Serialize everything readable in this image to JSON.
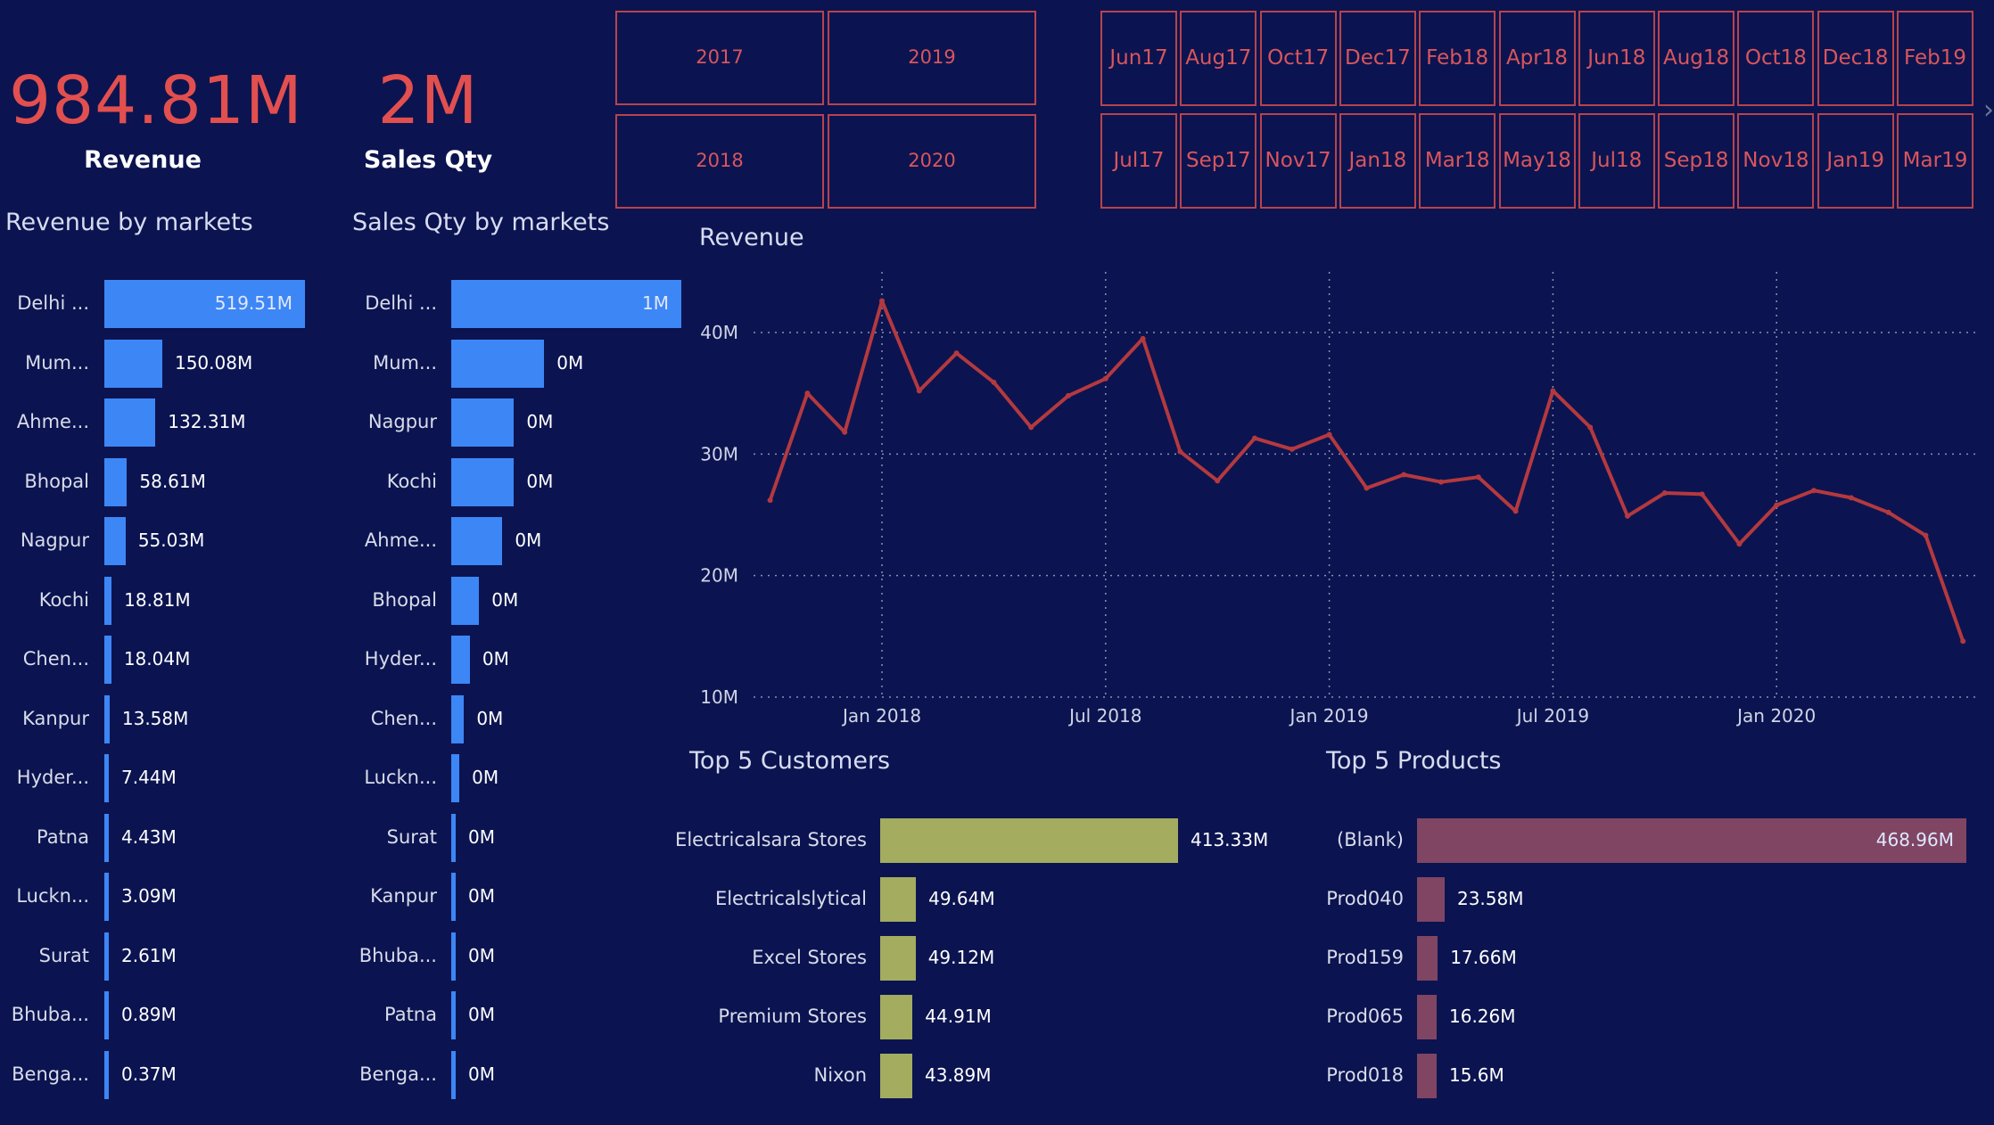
{
  "kpis": {
    "revenue": {
      "value": "984.81M",
      "label": "Revenue"
    },
    "sales_qty": {
      "value": "2M",
      "label": "Sales Qty"
    }
  },
  "year_slicer": {
    "items": [
      "2017",
      "2019",
      "2018",
      "2020"
    ]
  },
  "month_slicer": {
    "top_row": [
      {
        "m": "Jun",
        "y": "17"
      },
      {
        "m": "Aug",
        "y": "17"
      },
      {
        "m": "Oct",
        "y": "17"
      },
      {
        "m": "Dec",
        "y": "17"
      },
      {
        "m": "Feb",
        "y": "18"
      },
      {
        "m": "Apr",
        "y": "18"
      },
      {
        "m": "Jun",
        "y": "18"
      },
      {
        "m": "Aug",
        "y": "18"
      },
      {
        "m": "Oct",
        "y": "18"
      },
      {
        "m": "Dec",
        "y": "18"
      },
      {
        "m": "Feb",
        "y": "19"
      }
    ],
    "bottom_row": [
      {
        "m": "Jul",
        "y": "17"
      },
      {
        "m": "Sep",
        "y": "17"
      },
      {
        "m": "Nov",
        "y": "17"
      },
      {
        "m": "Jan",
        "y": "18"
      },
      {
        "m": "Mar",
        "y": "18"
      },
      {
        "m": "May",
        "y": "18"
      },
      {
        "m": "Jul",
        "y": "18"
      },
      {
        "m": "Sep",
        "y": "18"
      },
      {
        "m": "Nov",
        "y": "18"
      },
      {
        "m": "Jan",
        "y": "19"
      },
      {
        "m": "Mar",
        "y": "19"
      }
    ],
    "scroll_icon": "chevron-right-icon"
  },
  "colors": {
    "background": "#0b1450",
    "kpi": "#e24f4f",
    "market_bar": "#3d86f5",
    "line": "#b4393f",
    "customer_bar": "#a3ac5f",
    "product_bar": "#7f4563",
    "slicer_border": "#b8434c"
  },
  "chart_data": [
    {
      "id": "revenue_by_markets",
      "type": "bar",
      "orientation": "horizontal",
      "title": "Revenue by markets",
      "categories": [
        "Delhi ...",
        "Mum...",
        "Ahme...",
        "Bhopal",
        "Nagpur",
        "Kochi",
        "Chen...",
        "Kanpur",
        "Hyder...",
        "Patna",
        "Luckn...",
        "Surat",
        "Bhuba...",
        "Benga..."
      ],
      "values": [
        519.51,
        150.08,
        132.31,
        58.61,
        55.03,
        18.81,
        18.04,
        13.58,
        7.44,
        4.43,
        3.09,
        2.61,
        0.89,
        0.37
      ],
      "labels": [
        "519.51M",
        "150.08M",
        "132.31M",
        "58.61M",
        "55.03M",
        "18.81M",
        "18.04M",
        "13.58M",
        "7.44M",
        "4.43M",
        "3.09M",
        "2.61M",
        "0.89M",
        "0.37M"
      ],
      "unit": "M"
    },
    {
      "id": "sales_qty_by_markets",
      "type": "bar",
      "orientation": "horizontal",
      "title": "Sales Qty by markets",
      "categories": [
        "Delhi ...",
        "Mum...",
        "Nagpur",
        "Kochi",
        "Ahme...",
        "Bhopal",
        "Hyder...",
        "Chen...",
        "Luckn...",
        "Surat",
        "Kanpur",
        "Bhuba...",
        "Patna",
        "Benga..."
      ],
      "values": [
        0.99,
        0.4,
        0.27,
        0.27,
        0.22,
        0.12,
        0.08,
        0.055,
        0.035,
        0.018,
        0.018,
        0.016,
        0.014,
        0.012
      ],
      "labels": [
        "1M",
        "0M",
        "0M",
        "0M",
        "0M",
        "0M",
        "0M",
        "0M",
        "0M",
        "0M",
        "0M",
        "0M",
        "0M",
        "0M"
      ],
      "unit": "M"
    },
    {
      "id": "revenue_trend",
      "type": "line",
      "title": "Revenue",
      "x": [
        "2017-10",
        "2017-11",
        "2017-12",
        "2018-01",
        "2018-02",
        "2018-03",
        "2018-04",
        "2018-05",
        "2018-06",
        "2018-07",
        "2018-08",
        "2018-09",
        "2018-10",
        "2018-11",
        "2018-12",
        "2019-01",
        "2019-02",
        "2019-03",
        "2019-04",
        "2019-05",
        "2019-06",
        "2019-07",
        "2019-08",
        "2019-09",
        "2019-10",
        "2019-11",
        "2019-12",
        "2020-01",
        "2020-02",
        "2020-03",
        "2020-04",
        "2020-05",
        "2020-06"
      ],
      "values": [
        26.2,
        35.0,
        31.8,
        42.6,
        35.2,
        38.3,
        35.9,
        32.2,
        34.8,
        36.2,
        39.5,
        30.2,
        27.8,
        31.3,
        30.4,
        31.6,
        27.2,
        28.3,
        27.7,
        28.1,
        25.3,
        35.2,
        32.2,
        24.9,
        26.8,
        26.7,
        22.6,
        25.8,
        27.0,
        26.4,
        25.2,
        23.3,
        14.6
      ],
      "x_ticks": [
        "Jan 2018",
        "Jul 2018",
        "Jan 2019",
        "Jul 2019",
        "Jan 2020"
      ],
      "y_ticks": [
        {
          "v": 10,
          "label": "10M"
        },
        {
          "v": 20,
          "label": "20M"
        },
        {
          "v": 30,
          "label": "30M"
        },
        {
          "v": 40,
          "label": "40M"
        }
      ],
      "ylim": [
        10,
        45
      ],
      "grid": true
    },
    {
      "id": "top5_customers",
      "type": "bar",
      "orientation": "horizontal",
      "title": "Top 5 Customers",
      "categories": [
        "Electricalsara Stores",
        "Electricalslytical",
        "Excel Stores",
        "Premium Stores",
        "Nixon"
      ],
      "values": [
        413.33,
        49.64,
        49.12,
        44.91,
        43.89
      ],
      "labels": [
        "413.33M",
        "49.64M",
        "49.12M",
        "44.91M",
        "43.89M"
      ],
      "unit": "M"
    },
    {
      "id": "top5_products",
      "type": "bar",
      "orientation": "horizontal",
      "title": "Top 5 Products",
      "categories": [
        "(Blank)",
        "Prod040",
        "Prod159",
        "Prod065",
        "Prod018"
      ],
      "values": [
        468.96,
        23.58,
        17.66,
        16.26,
        15.6
      ],
      "labels": [
        "468.96M",
        "23.58M",
        "17.66M",
        "16.26M",
        "15.6M"
      ],
      "unit": "M"
    }
  ]
}
